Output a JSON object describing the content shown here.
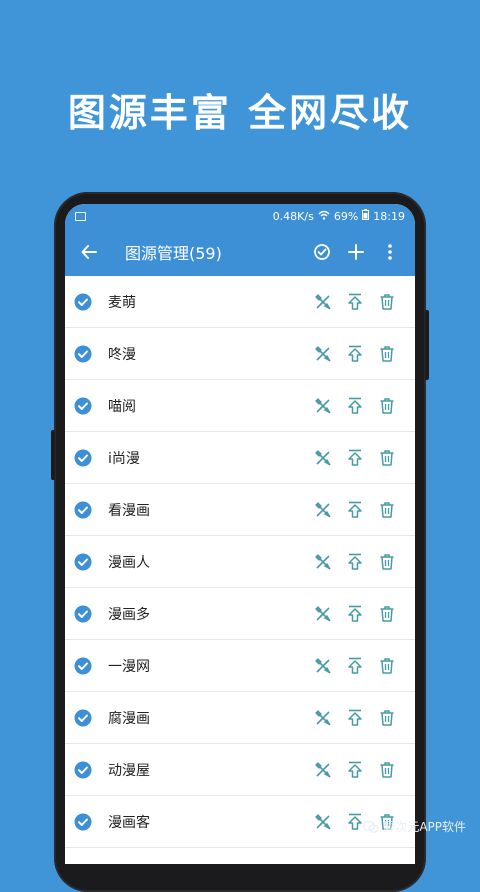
{
  "headline": "图源丰富  全网尽收",
  "status_bar": {
    "speed": "0.48K/s",
    "battery": "69%",
    "time": "18:19"
  },
  "app_bar": {
    "title": "图源管理(59)",
    "back_icon": "arrow-left-icon",
    "actions": [
      "check-circle-icon",
      "plus-icon",
      "more-vert-icon"
    ]
  },
  "sources": [
    {
      "name": "麦萌",
      "checked": true
    },
    {
      "name": "咚漫",
      "checked": true
    },
    {
      "name": "喵阅",
      "checked": true
    },
    {
      "name": "i尚漫",
      "checked": true
    },
    {
      "name": "看漫画",
      "checked": true
    },
    {
      "name": "漫画人",
      "checked": true
    },
    {
      "name": "漫画多",
      "checked": true
    },
    {
      "name": "一漫网",
      "checked": true
    },
    {
      "name": "腐漫画",
      "checked": true
    },
    {
      "name": "动漫屋",
      "checked": true
    },
    {
      "name": "漫画客",
      "checked": true
    }
  ],
  "row_actions": [
    "edit-icon",
    "move-to-top-icon",
    "delete-icon"
  ],
  "watermark": "异次元APP软件",
  "colors": {
    "background": "#3f95d8",
    "app_bar": "#3d8fd6",
    "icon_teal": "#4a9aa6",
    "check_blue": "#3d8fd6"
  }
}
